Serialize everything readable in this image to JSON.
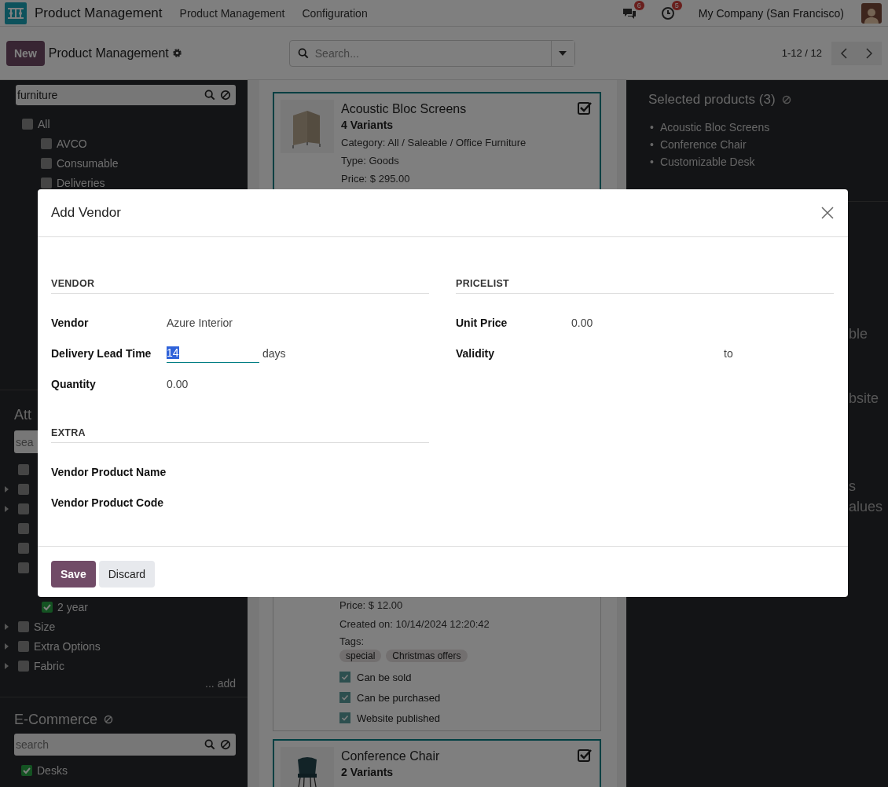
{
  "navbar": {
    "app_name": "Product Management",
    "menu": [
      "Product Management",
      "Configuration"
    ],
    "messages_badge": "6",
    "activities_badge": "5",
    "company": "My Company (San Francisco)"
  },
  "control_panel": {
    "new_button": "New",
    "title": "Product Management",
    "search_placeholder": "Search...",
    "pager": "1-12 / 12"
  },
  "left_panel": {
    "category_search": {
      "value": "furniture"
    },
    "categories": [
      {
        "label": "All",
        "checked": false,
        "children": [
          {
            "label": "AVCO",
            "checked": false
          },
          {
            "label": "Consumable",
            "checked": false
          },
          {
            "label": "Deliveries",
            "checked": false
          }
        ]
      }
    ],
    "attributes_heading": "Att",
    "attribute_search": {
      "placeholder": "sea"
    },
    "attribute_rows_hidden": [
      {
        "checked": false,
        "expandable": false
      },
      {
        "checked": false,
        "expandable": true
      },
      {
        "checked": false,
        "expandable": true
      },
      {
        "checked": false,
        "expandable": false
      },
      {
        "checked": false,
        "expandable": false
      },
      {
        "checked": false,
        "expandable": false
      }
    ],
    "attribute_child": {
      "label": "2 year",
      "checked": true
    },
    "attributes": [
      {
        "label": "Size",
        "checked": false,
        "expandable": true
      },
      {
        "label": "Extra Options",
        "checked": false,
        "expandable": true
      },
      {
        "label": "Fabric",
        "checked": false,
        "expandable": true
      }
    ],
    "add_link": "... add",
    "ecommerce_heading": "E-Commerce",
    "ecommerce_search": {
      "placeholder": "search"
    },
    "ecommerce_items": [
      {
        "label": "Desks",
        "checked": true
      }
    ]
  },
  "products": [
    {
      "kind": "top",
      "name": "Acoustic Bloc Screens",
      "variants": "4 Variants",
      "lines": [
        "Category: All / Saleable / Office Furniture",
        "Type: Goods",
        "Price: $ 295.00"
      ],
      "selected": true
    },
    {
      "kind": "bottom",
      "lines": [
        "Price: $ 12.00",
        "Created on: 10/14/2024 12:20:42",
        "Tags:"
      ],
      "tags": [
        "special",
        "Christmas offers"
      ],
      "flags": [
        {
          "label": "Can be sold",
          "checked": true
        },
        {
          "label": "Can be purchased",
          "checked": true
        },
        {
          "label": "Website published",
          "checked": true
        }
      ],
      "selected": false
    },
    {
      "kind": "top",
      "name": "Conference Chair",
      "variants": "2 Variants",
      "selected": true
    }
  ],
  "right_panel": {
    "heading": "Selected products (3)",
    "items": [
      {
        "marker": "•",
        "label": "Acoustic Bloc Screens"
      },
      {
        "marker": "•",
        "label": "Conference Chair"
      },
      {
        "marker": "•",
        "label": "Customizable Desk"
      }
    ],
    "fragments": [
      "ble",
      "bsite",
      "s",
      "alues"
    ]
  },
  "dialog": {
    "title": "Add Vendor",
    "sections": [
      {
        "heading": "VENDOR",
        "rows": [
          {
            "kind": "text",
            "label": "Vendor",
            "value": "Azure Interior"
          },
          {
            "kind": "input",
            "label": "Delivery Lead Time",
            "value": "14",
            "text_selected": true,
            "suffix": "days"
          },
          {
            "kind": "text",
            "label": "Quantity",
            "value": "0.00"
          }
        ]
      },
      {
        "heading": "PRICELIST",
        "rows": [
          {
            "kind": "text",
            "label": "Unit Price",
            "value": "0.00"
          },
          {
            "kind": "range",
            "label": "Validity",
            "separator": "to"
          }
        ]
      },
      {
        "heading": "EXTRA",
        "rows": [
          {
            "kind": "empty",
            "label": "Vendor Product Name"
          },
          {
            "kind": "empty",
            "label": "Vendor Product Code"
          }
        ]
      }
    ],
    "buttons": [
      {
        "label": "Save",
        "kind": "primary"
      },
      {
        "label": "Discard",
        "kind": "secondary"
      }
    ]
  }
}
